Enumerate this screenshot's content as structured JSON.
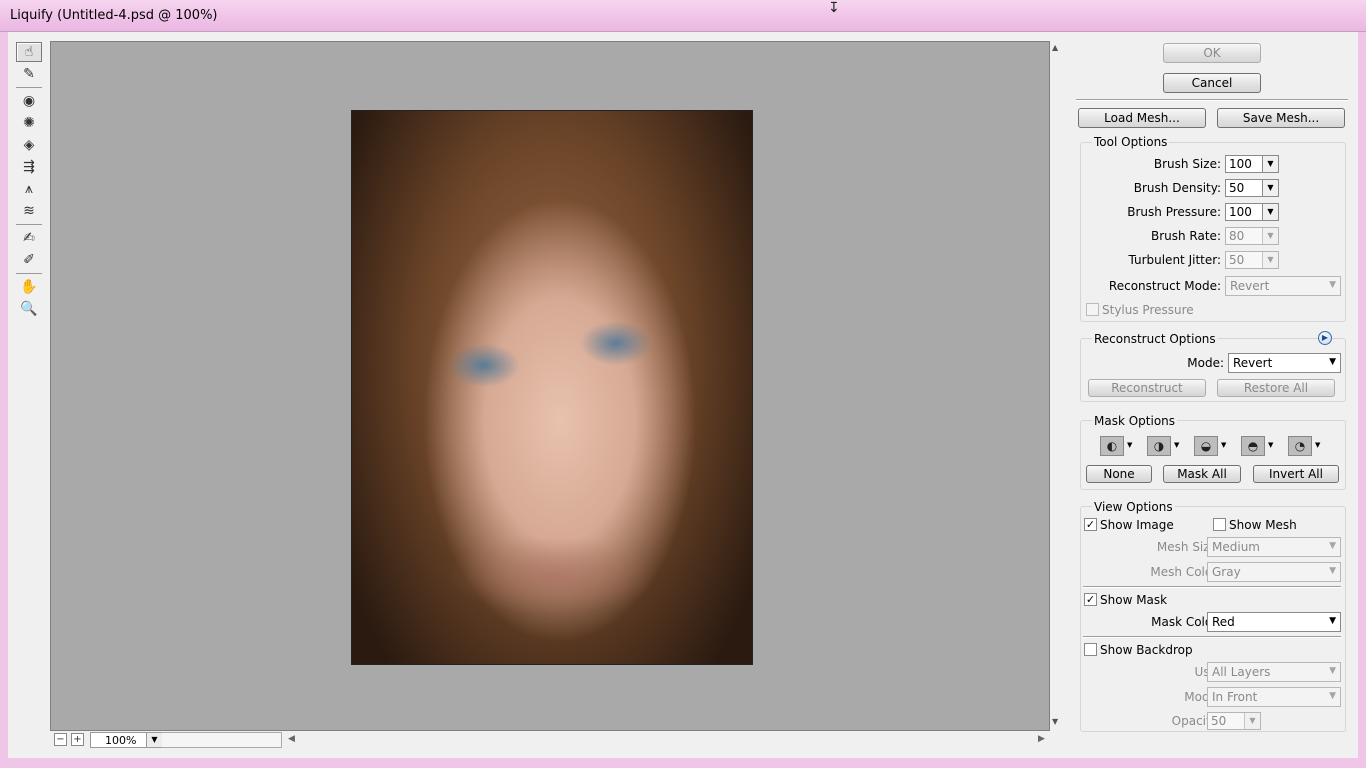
{
  "window": {
    "title": "Liquify (Untitled-4.psd @ 100%)"
  },
  "toolbar": {
    "tools": [
      {
        "icon": "forward-warp-icon",
        "glyph": "☝"
      },
      {
        "icon": "reconstruct-icon",
        "glyph": "✎"
      },
      {
        "icon": "twirl-icon",
        "glyph": "◉"
      },
      {
        "icon": "pucker-icon",
        "glyph": "✺"
      },
      {
        "icon": "bloat-icon",
        "glyph": "◈"
      },
      {
        "icon": "push-left-icon",
        "glyph": "⇶"
      },
      {
        "icon": "mirror-icon",
        "glyph": "⩚"
      },
      {
        "icon": "turbulence-icon",
        "glyph": "≋"
      },
      {
        "icon": "freeze-mask-icon",
        "glyph": "✍"
      },
      {
        "icon": "thaw-mask-icon",
        "glyph": "✐"
      },
      {
        "icon": "hand-icon",
        "glyph": "✋"
      },
      {
        "icon": "zoom-icon",
        "glyph": "🔍"
      }
    ]
  },
  "canvas": {
    "zoom": "100%",
    "zoom_out": "−",
    "zoom_in": "+"
  },
  "buttons": {
    "ok": "OK",
    "cancel": "Cancel",
    "load_mesh": "Load Mesh...",
    "save_mesh": "Save Mesh..."
  },
  "tool_options": {
    "title": "Tool Options",
    "brush_size": {
      "label": "Brush Size:",
      "value": "100"
    },
    "brush_density": {
      "label": "Brush Density:",
      "value": "50"
    },
    "brush_pressure": {
      "label": "Brush Pressure:",
      "value": "100"
    },
    "brush_rate": {
      "label": "Brush Rate:",
      "value": "80"
    },
    "turbulent_jitter": {
      "label": "Turbulent Jitter:",
      "value": "50"
    },
    "reconstruct_mode": {
      "label": "Reconstruct Mode:",
      "value": "Revert"
    },
    "stylus_pressure": {
      "label": "Stylus Pressure",
      "checked": false
    }
  },
  "reconstruct_options": {
    "title": "Reconstruct Options",
    "mode": {
      "label": "Mode:",
      "value": "Revert"
    },
    "reconstruct": "Reconstruct",
    "restore_all": "Restore All"
  },
  "mask_options": {
    "title": "Mask Options",
    "modes": [
      {
        "icon": "mask-replace-icon",
        "glyph": "◐"
      },
      {
        "icon": "mask-add-icon",
        "glyph": "◑"
      },
      {
        "icon": "mask-subtract-icon",
        "glyph": "◒"
      },
      {
        "icon": "mask-intersect-icon",
        "glyph": "◓"
      },
      {
        "icon": "mask-invert-icon",
        "glyph": "◔"
      }
    ],
    "none": "None",
    "mask_all": "Mask All",
    "invert_all": "Invert All"
  },
  "view_options": {
    "title": "View Options",
    "show_image": {
      "label": "Show Image",
      "checked": true
    },
    "show_mesh": {
      "label": "Show Mesh",
      "checked": false
    },
    "mesh_size": {
      "label": "Mesh Size:",
      "value": "Medium"
    },
    "mesh_color": {
      "label": "Mesh Color:",
      "value": "Gray"
    },
    "show_mask": {
      "label": "Show Mask",
      "checked": true
    },
    "mask_color": {
      "label": "Mask Color:",
      "value": "Red"
    },
    "show_backdrop": {
      "label": "Show Backdrop",
      "checked": false
    },
    "use": {
      "label": "Use:",
      "value": "All Layers"
    },
    "mode": {
      "label": "Mode:",
      "value": "In Front"
    },
    "opacity": {
      "label": "Opacity:",
      "value": "50"
    }
  },
  "glyphs": {
    "check": "✓",
    "dropdown": "▼",
    "play": "▶",
    "up": "▲",
    "down": "▼",
    "left": "◀",
    "right": "▶",
    "cursor": "↧"
  },
  "colors": {
    "titlebar": "#f0c3e8",
    "canvas_bg": "#a9a9a9",
    "panel_bg": "#f0f0f0"
  }
}
